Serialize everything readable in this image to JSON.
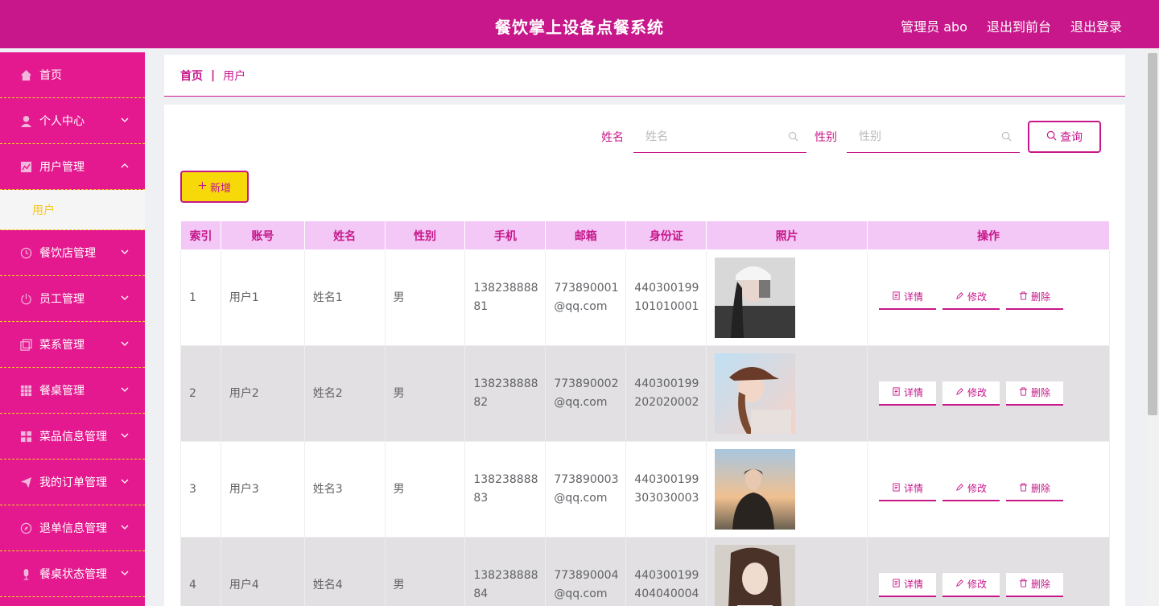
{
  "header": {
    "title": "餐饮掌上设备点餐系统",
    "admin_label": "管理员 abo",
    "front_link": "退出到前台",
    "logout_link": "退出登录"
  },
  "sidebar": {
    "items": [
      {
        "label": "首页",
        "icon": "home-icon"
      },
      {
        "label": "个人中心",
        "icon": "user-icon"
      },
      {
        "label": "用户管理",
        "icon": "chart-icon"
      },
      {
        "label": "餐饮店管理",
        "icon": "clock-icon"
      },
      {
        "label": "员工管理",
        "icon": "power-icon"
      },
      {
        "label": "菜系管理",
        "icon": "copy-icon"
      },
      {
        "label": "餐桌管理",
        "icon": "grid-icon"
      },
      {
        "label": "菜品信息管理",
        "icon": "apps-icon"
      },
      {
        "label": "我的订单管理",
        "icon": "send-icon"
      },
      {
        "label": "退单信息管理",
        "icon": "compass-icon"
      },
      {
        "label": "餐桌状态管理",
        "icon": "mic-icon"
      }
    ],
    "submenu_label": "用户"
  },
  "breadcrumb": {
    "home": "首页",
    "separator": "|",
    "current": "用户"
  },
  "search": {
    "name_label": "姓名",
    "name_placeholder": "姓名",
    "gender_label": "性别",
    "gender_placeholder": "性别",
    "query_label": "查询"
  },
  "add_label": "新增",
  "table": {
    "headers": [
      "索引",
      "账号",
      "姓名",
      "性别",
      "手机",
      "邮箱",
      "身份证",
      "照片",
      "操作"
    ],
    "rows": [
      {
        "index": "1",
        "account": "用户1",
        "name": "姓名1",
        "gender": "男",
        "phone_1": "138238888",
        "phone_2": "81",
        "email_1": "773890001",
        "email_2": "@qq.com",
        "id_1": "440300199",
        "id_2": "101010001"
      },
      {
        "index": "2",
        "account": "用户2",
        "name": "姓名2",
        "gender": "男",
        "phone_1": "138238888",
        "phone_2": "82",
        "email_1": "773890002",
        "email_2": "@qq.com",
        "id_1": "440300199",
        "id_2": "202020002"
      },
      {
        "index": "3",
        "account": "用户3",
        "name": "姓名3",
        "gender": "男",
        "phone_1": "138238888",
        "phone_2": "83",
        "email_1": "773890003",
        "email_2": "@qq.com",
        "id_1": "440300199",
        "id_2": "303030003"
      },
      {
        "index": "4",
        "account": "用户4",
        "name": "姓名4",
        "gender": "男",
        "phone_1": "138238888",
        "phone_2": "84",
        "email_1": "773890004",
        "email_2": "@qq.com",
        "id_1": "440300199",
        "id_2": "404040004"
      }
    ],
    "actions": {
      "detail": "详情",
      "edit": "修改",
      "delete": "删除"
    }
  },
  "colors": {
    "primary": "#c7178a",
    "sidebar": "#e5198f",
    "accent": "#f7d90a",
    "header_row": "#f3c7f6"
  }
}
